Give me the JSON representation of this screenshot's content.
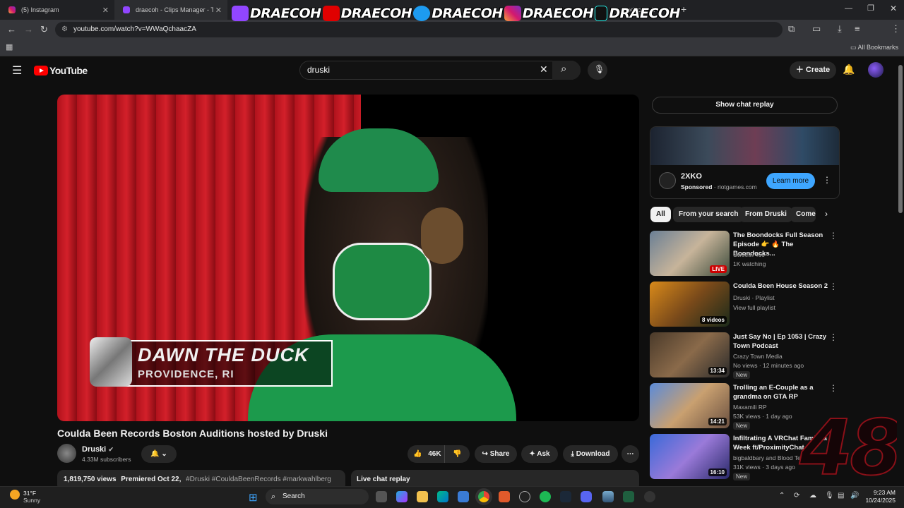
{
  "browser": {
    "tabs": [
      {
        "title": "(5) Instagram",
        "close": "✕"
      },
      {
        "title": "draecoh - Clips Manager - Twitch",
        "close": "✕"
      },
      {
        "title": "oducer - T",
        "close": "✕"
      }
    ],
    "new_tab": "+",
    "url": "youtube.com/watch?v=WWaQchaacZA",
    "all_bookmarks": "All Bookmarks"
  },
  "overlay": {
    "handles": [
      "DRAECOH",
      "DRAECOH",
      "DRAECOH",
      "DRAECOH",
      "DRAECOH"
    ],
    "counter": "48"
  },
  "youtube": {
    "logo": "YouTube",
    "search_value": "druski",
    "create_label": "Create"
  },
  "video": {
    "lower_third_name": "DAWN THE DUCK",
    "lower_third_place": "PROVIDENCE, RI",
    "title": "Coulda Been Records Boston Auditions hosted by Druski",
    "channel": "Druski",
    "subscribers": "4.33M subscribers",
    "likes": "46K",
    "share": "Share",
    "ask": "Ask",
    "download": "Download",
    "views": "1,819,750 views",
    "premiered": "Premiered Oct 22,",
    "tags": "#Druski #CouldaBeenRecords #markwahlberg",
    "live_chat_replay": "Live chat replay"
  },
  "sidebar": {
    "show_chat_replay": "Show chat replay",
    "ad": {
      "name": "2XKO",
      "sponsored": "Sponsored",
      "domain": "riotgames.com",
      "cta": "Learn more"
    },
    "chips": [
      "All",
      "From your search",
      "From Druski",
      "Comedy"
    ],
    "recommendations": [
      {
        "title": "The Boondocks Full Season Episode 👉 🔥 The Boondocks...",
        "channel": "Sweett7466",
        "meta": "1K watching",
        "badge": "LIVE"
      },
      {
        "title": "Coulda Been House Season 2",
        "channel": "Druski · Playlist",
        "meta": "View full playlist",
        "badge": "8 videos"
      },
      {
        "title": "Just Say No | Ep 1053 | Crazy Town Podcast",
        "channel": "Crazy Town Media",
        "meta": "No views · 12 minutes ago",
        "badge": "13:34",
        "new": "New"
      },
      {
        "title": "Trolling an E-Couple as a grandma on GTA RP",
        "channel": "Maxamili RP",
        "meta": "53K views · 1 day ago",
        "badge": "14:21",
        "new": "New"
      },
      {
        "title": "Infiltrating A VRChat Family a Week ft/ProximityChat",
        "channel": "bigbaldbary and Blood Tea",
        "meta": "31K views · 3 days ago",
        "badge": "16:10",
        "new": "New"
      }
    ]
  },
  "taskbar": {
    "weather_temp": "31°F",
    "weather_desc": "Sunny",
    "search_label": "Search",
    "time": "9:23 AM",
    "date": "10/24/2025"
  }
}
